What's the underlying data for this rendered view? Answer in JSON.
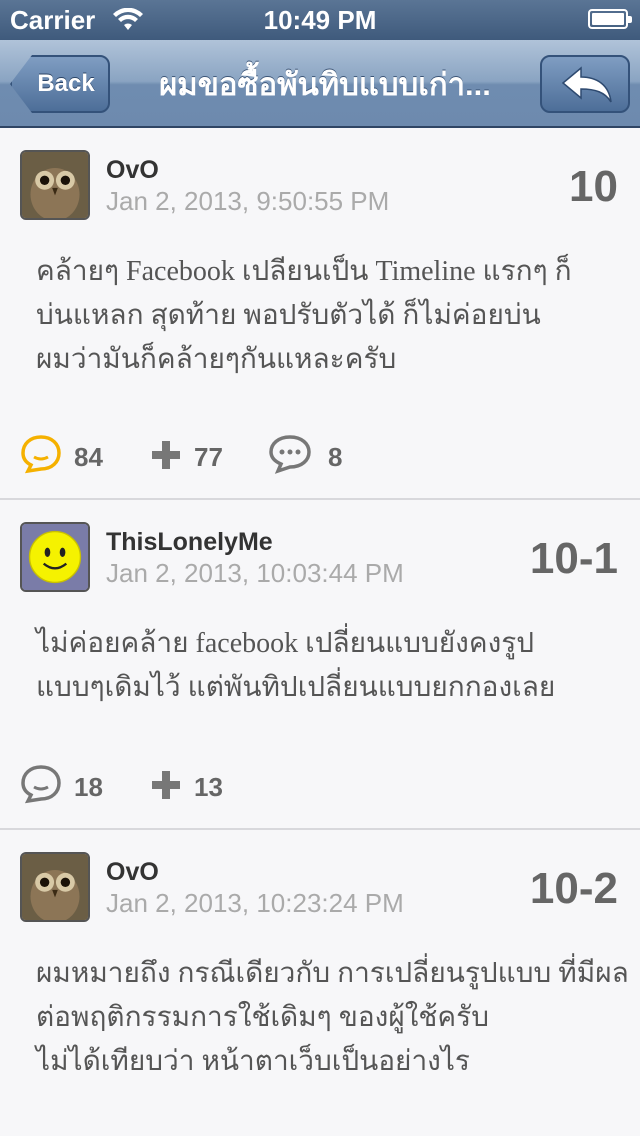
{
  "status_bar": {
    "carrier": "Carrier",
    "time": "10:49 PM"
  },
  "nav": {
    "back_label": "Back",
    "title": "ผมขอซื้อพันทิบแบบเก่า..."
  },
  "posts": [
    {
      "username": "OvO",
      "date": "Jan 2, 2013, 9:50:55 PM",
      "number": "10",
      "body": [
        "คล้ายๆ Facebook เปลียนเป็น Timeline แรกๆ ก็",
        "บ่นแหลก  สุดท้าย พอปรับตัวได้ ก็ไม่ค่อยบ่น",
        "ผมว่ามันก็คล้ายๆกันแหละครับ"
      ],
      "emotions": "84",
      "plus": "77",
      "comments": "8"
    },
    {
      "username": "ThisLonelyMe",
      "date": "Jan 2, 2013, 10:03:44 PM",
      "number": "10-1",
      "body": [
        "ไม่ค่อยคล้าย   facebook เปลี่ยนแบบยังคงรูป",
        "แบบๆเดิมไว้  แต่พันทิปเปลี่ยนแบบยกกองเลย"
      ],
      "emotions": "18",
      "plus": "13"
    },
    {
      "username": "OvO",
      "date": "Jan 2, 2013, 10:23:24 PM",
      "number": "10-2",
      "body": [
        "ผมหมายถึง กรณีเดียวกับ การเปลี่ยนรูปแบบ  ที่มีผล",
        "ต่อพฤติกรรมการใช้เดิมๆ ของผู้ใช้ครับ",
        "ไม่ได้เทียบว่า หน้าตาเว็บเป็นอย่างไร"
      ]
    }
  ],
  "colors": {
    "nav_bar": "#8aa4c2",
    "status_bar": "#4a6688",
    "emotion_active": "#f5b100",
    "icon_gray": "#777777"
  }
}
